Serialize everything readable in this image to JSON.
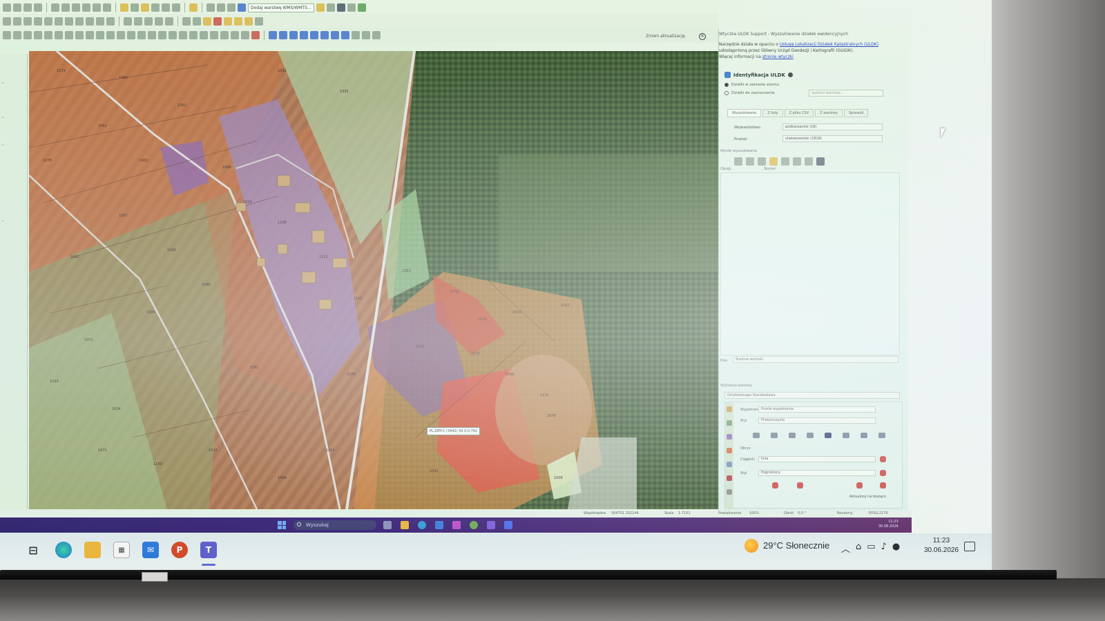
{
  "toolbar": {
    "field_text": "Dodaj warstwę WMS/WMTS..."
  },
  "search": {
    "update_label": "Zmień aktualizację",
    "close_icon": "close-icon"
  },
  "map": {
    "parcel_labels": [
      "1173",
      "1050",
      "1011",
      "1352",
      "1332",
      "1052",
      "1078",
      "1001",
      "1084",
      "1014",
      "1067",
      "1082",
      "1090",
      "1109",
      "1150",
      "1088",
      "1099",
      "1071",
      "1123",
      "1014",
      "1130",
      "2263",
      "1103",
      "1141",
      "1133",
      "1043",
      "1062",
      "1071",
      "1070",
      "1050",
      "1104",
      "1132",
      "1079",
      "1008",
      "1041",
      "1013",
      "1068",
      "1022",
      "1071",
      "1082"
    ],
    "tooltip": "PL.ZIPP.1 (3442) 50.0,0.792"
  },
  "right_panel": {
    "title": "Wtyczka ULDK Support - Wyszukiwanie działek ewidencyjnych",
    "intro_1": "Narzędzie działa w oparciu o ",
    "intro_link": "Usługę Lokalizacji Działek Katastralnych (ULDK)",
    "intro_2": " udostępnioną przez Główny Urząd Geodezji i Kartografii (GUGiK).",
    "intro_3": "Więcej informacji na ",
    "intro_link2": "stronie wtyczki",
    "ident_label": "Identyfikacja ULDK",
    "radio_1": "Działki w zakresie zoomu",
    "radio_2": "Działki do zaznaczenia",
    "combo_top_placeholder": "wybierz warstwę...",
    "tabs": [
      "Wyszukiwanie",
      "Z listy",
      "Z pliku CSV",
      "Z warstwy",
      "Sprawdź"
    ],
    "row1_label": "Województwo:",
    "row1_value": "podkarpackie (18)",
    "row2_label": "Powiat:",
    "row2_value": "stalowowolski (1818)",
    "results_label": "Wyniki wyszukiwania",
    "results_head_1": "Obręb",
    "results_head_2": "Numer",
    "pole_label": "Pole",
    "pole_value": "Średnia wartość",
    "style_label": "Stylizacja warstwy",
    "style_value": "Ortofotomapa Standardowa",
    "sb_rows": [
      {
        "label": "Wypełnienie",
        "value": "Proste wypełnienie"
      },
      {
        "label": "Styl",
        "value": "Przezroczyste"
      },
      {
        "label": "Obrys",
        "value": ""
      },
      {
        "label": "Ciągłość",
        "value": "linia"
      },
      {
        "label": "Styl",
        "value": "Pogrubiony"
      }
    ],
    "render_label": "Renderuj",
    "refresh_label": "Aktualizuj na bieżąco"
  },
  "statusbar": {
    "coords_label": "Współrzędne",
    "coords_value": "564751  252144",
    "scale_label": "Skala",
    "scale_value": "1:7151",
    "magnifier_label": "Powiększenie",
    "magnifier_value": "100%",
    "rotation_label": "Obrót",
    "rotation_value": "0,0 °",
    "render_label": "Renderuj",
    "crs": "EPSG:2176"
  },
  "inner_taskbar": {
    "search_label": "Wyszukaj",
    "time": "11:23",
    "date": "30.06.2026"
  },
  "outer_taskbar": {
    "powerpoint_letter": "P",
    "teams_letter": "T",
    "weather": "29°C  Słonecznie",
    "time": "11:23",
    "date": "30.06.2026"
  }
}
